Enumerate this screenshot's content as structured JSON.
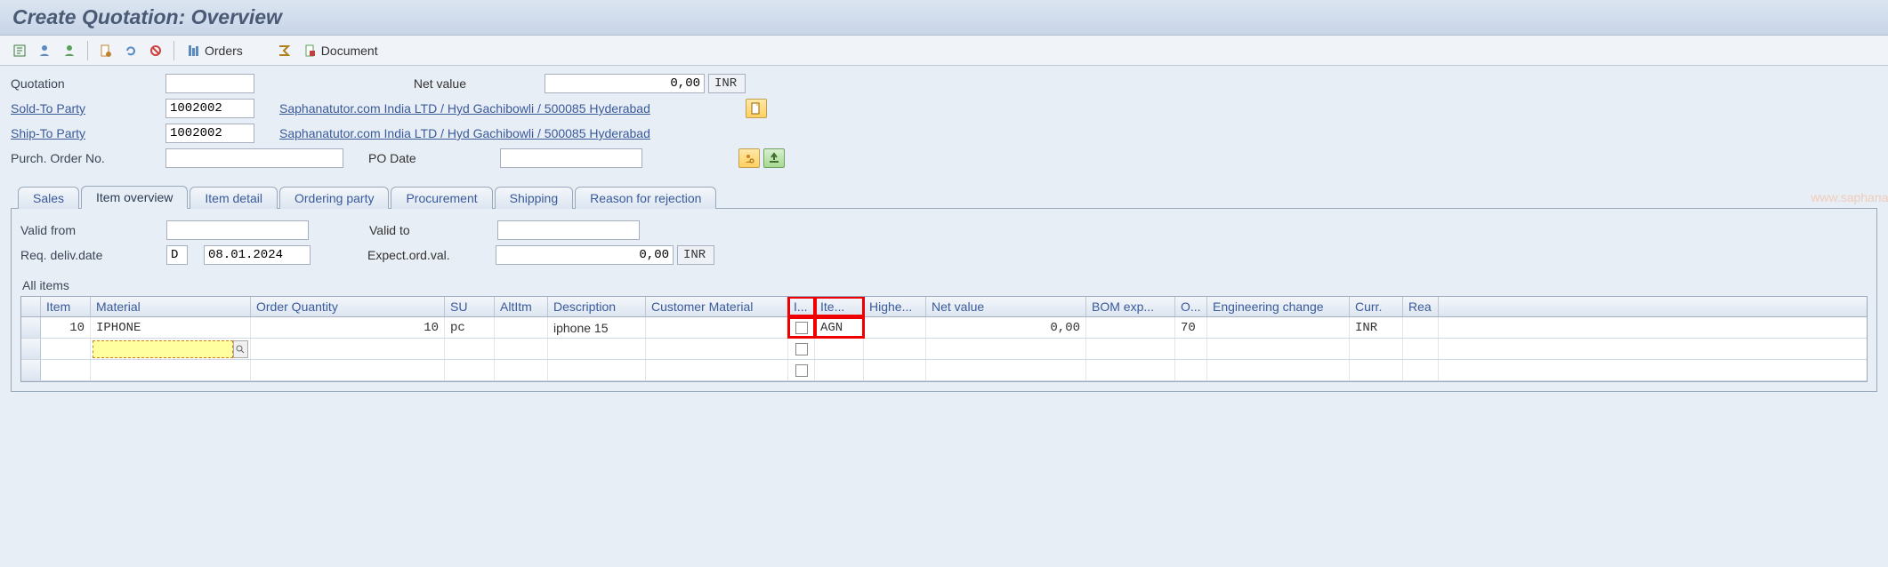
{
  "title": "Create Quotation: Overview",
  "toolbar": {
    "orders_label": "Orders",
    "document_label": "Document"
  },
  "header": {
    "quotation_label": "Quotation",
    "quotation_value": "",
    "netvalue_label": "Net value",
    "netvalue_value": "0,00",
    "netvalue_curr": "INR",
    "soldto_label": "Sold-To Party",
    "soldto_value": "1002002",
    "soldto_desc": "Saphanatutor.com India LTD / Hyd Gachibowli / 500085 Hyderabad",
    "shipto_label": "Ship-To Party",
    "shipto_value": "1002002",
    "shipto_desc": "Saphanatutor.com India LTD / Hyd Gachibowli / 500085 Hyderabad",
    "po_label": "Purch. Order No.",
    "po_value": "",
    "podate_label": "PO Date",
    "podate_value": ""
  },
  "tabs": [
    "Sales",
    "Item overview",
    "Item detail",
    "Ordering party",
    "Procurement",
    "Shipping",
    "Reason for rejection"
  ],
  "active_tab": 1,
  "overview": {
    "validfrom_label": "Valid from",
    "validfrom_value": "",
    "validto_label": "Valid to",
    "validto_value": "",
    "reqdate_label": "Req. deliv.date",
    "reqdate_type": "D",
    "reqdate_value": "08.01.2024",
    "expectval_label": "Expect.ord.val.",
    "expectval_value": "0,00",
    "expectval_curr": "INR"
  },
  "grid": {
    "section_label": "All items",
    "columns": [
      "Item",
      "Material",
      "Order Quantity",
      "SU",
      "AltItm",
      "Description",
      "Customer Material",
      "I...",
      "Ite...",
      "Highe...",
      "Net value",
      "BOM exp...",
      "O...",
      "Engineering change",
      "Curr.",
      "Rea"
    ],
    "rows": [
      {
        "item": "10",
        "material": "IPHONE",
        "qty": "10",
        "su": "pc",
        "alt": "",
        "desc": "iphone 15",
        "cust": "",
        "i_chk": false,
        "ite": "AGN",
        "high": "",
        "net": "0,00",
        "bom": "",
        "o": "70",
        "eng": "",
        "curr": "INR",
        "rea": ""
      }
    ]
  },
  "watermark_text": "www.saphanatutor.com"
}
